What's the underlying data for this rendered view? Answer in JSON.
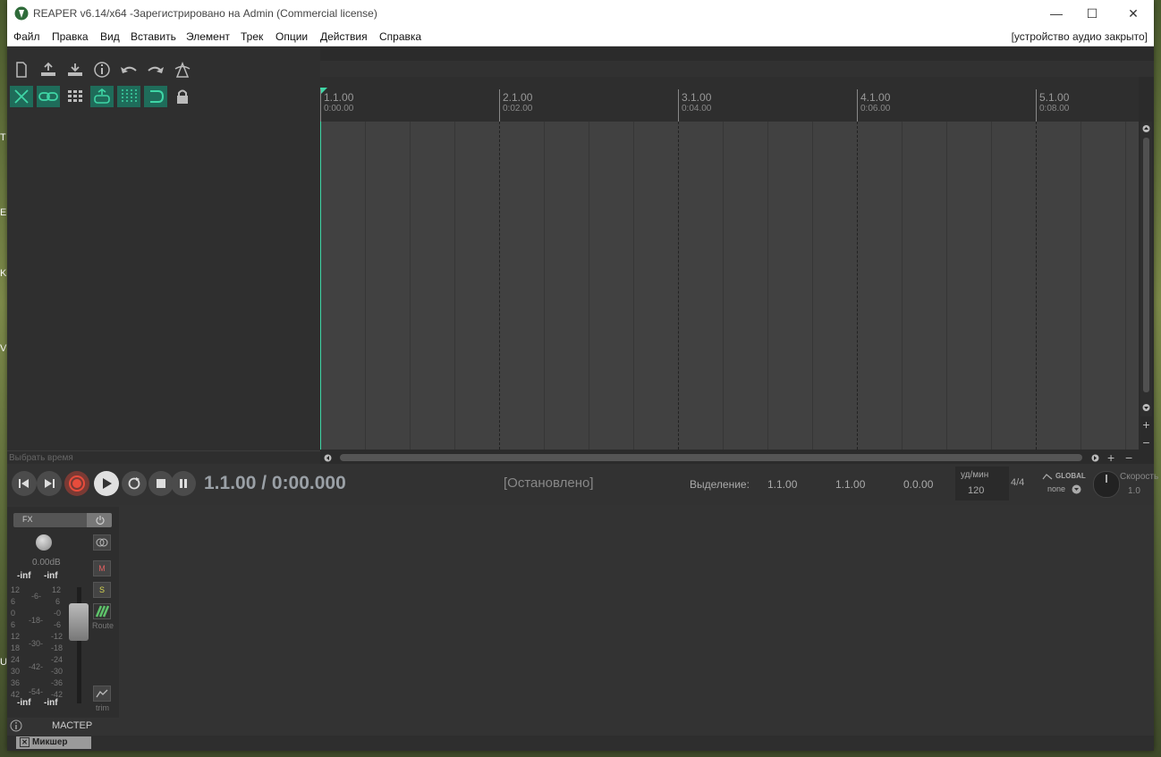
{
  "window": {
    "title": "REAPER v6.14/x64 -Зарегистрировано на Admin (Commercial license)"
  },
  "window_controls": {
    "minimize": "—",
    "maximize": "☐",
    "close": "✕"
  },
  "menu": {
    "items": [
      "Файл",
      "Правка",
      "Вид",
      "Вставить",
      "Элемент",
      "Трек",
      "Опции",
      "Действия",
      "Справка"
    ],
    "audio_status": "[устройство аудио закрыто]"
  },
  "toolbar": {
    "icons": [
      "new-project-icon",
      "open-project-icon",
      "save-project-icon",
      "project-settings-icon",
      "undo-icon",
      "redo-icon",
      "metronome-icon"
    ],
    "toggles": [
      "ripple-edit-icon",
      "grouping-icon",
      "grid-icon",
      "item-snap-icon",
      "snap-icon",
      "loop-icon",
      "lock-icon"
    ]
  },
  "tcp": {
    "select_time_label": "Выбрать время"
  },
  "ruler": {
    "marks": [
      {
        "bar": "1.1.00",
        "time": "0:00.00"
      },
      {
        "bar": "2.1.00",
        "time": "0:02.00"
      },
      {
        "bar": "3.1.00",
        "time": "0:04.00"
      },
      {
        "bar": "4.1.00",
        "time": "0:06.00"
      },
      {
        "bar": "5.1.00",
        "time": "0:08.00"
      }
    ]
  },
  "transport": {
    "position": "1.1.00 / 0:00.000",
    "state": "[Остановлено]",
    "selection_label": "Выделение:",
    "selection_start": "1.1.00",
    "selection_end": "1.1.00",
    "selection_length": "0.0.00",
    "bpm_label": "уд/мин",
    "bpm_value": "120",
    "time_sig": "4/4",
    "global_label": "GLOBAL",
    "global_mode": "none",
    "rate_label": "Скорость",
    "rate_value": "1.0"
  },
  "master": {
    "fx_label": "FX",
    "volume_db": "0.00dB",
    "peak_left_top": "-inf",
    "peak_right_top": "-inf",
    "peak_left_bottom": "-inf",
    "peak_right_bottom": "-inf",
    "mute": "M",
    "solo": "S",
    "route": "Route",
    "trim": "trim",
    "name": "МАСТЕР",
    "scale_left": [
      "12",
      "6",
      "0",
      "6",
      "12",
      "18",
      "24",
      "30",
      "36",
      "42"
    ],
    "scale_mid": [
      "-6-",
      "-18-",
      "-30-",
      "-42-",
      "-54-"
    ],
    "scale_right": [
      "12",
      "6",
      "-0",
      "-6",
      "-12",
      "-18",
      "-24",
      "-30",
      "-36",
      "-42"
    ]
  },
  "mixer_tab": {
    "label": "Микшер"
  }
}
